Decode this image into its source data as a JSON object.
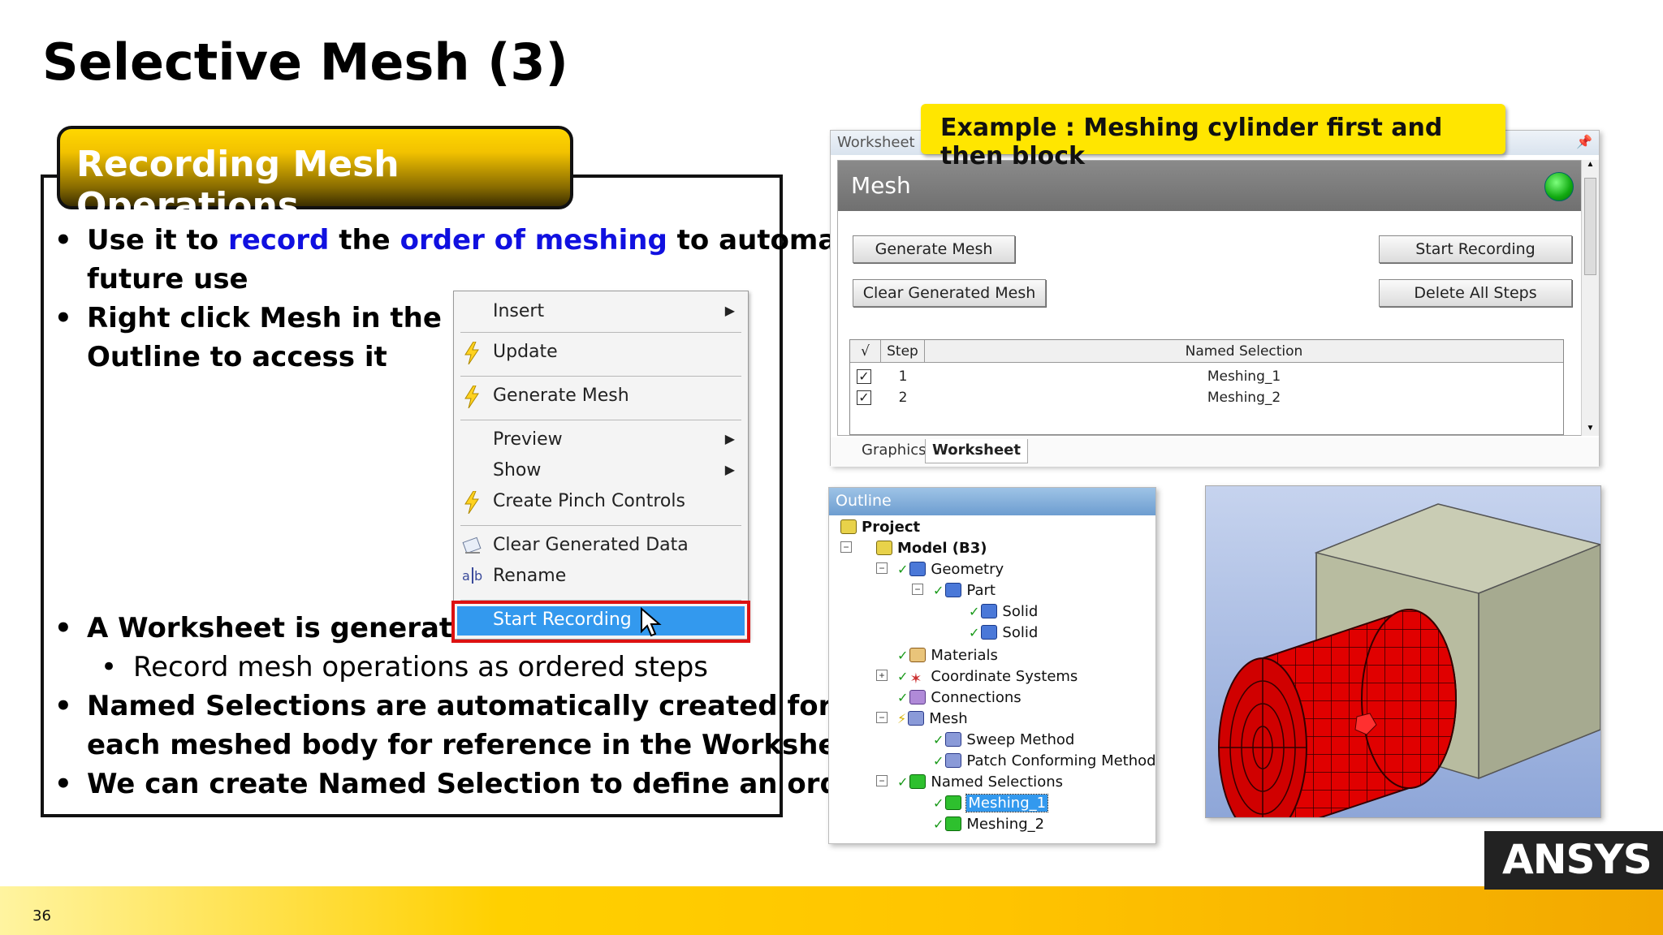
{
  "slide": {
    "title": "Selective Mesh (3)",
    "page_number": "36"
  },
  "section": {
    "title": "Recording Mesh Operations"
  },
  "bullets": {
    "b1_part1": "Use it to ",
    "b1_hl1": "record",
    "b1_part2": " the ",
    "b1_hl2": "order of meshing",
    "b1_part3": " to automate",
    "b1_line2": "future use",
    "b2_line1": "Right click Mesh in the",
    "b2_line2": "Outline to access it",
    "b3": "A Worksheet is generated",
    "b3_sub": "Record mesh operations as ordered steps",
    "b4_line1": "Named Selections are automatically created for",
    "b4_line2": "each meshed body for reference in the Worksheet",
    "b5": "We can create Named Selection to define an order"
  },
  "context_menu": {
    "items": [
      {
        "label": "Insert",
        "has_submenu": true
      },
      {
        "label": "Update",
        "icon": "lightning-icon"
      },
      {
        "label": "Generate Mesh",
        "icon": "lightning-icon"
      },
      {
        "label": "Preview",
        "has_submenu": true
      },
      {
        "label": "Show",
        "has_submenu": true
      },
      {
        "label": "Create Pinch Controls",
        "icon": "lightning-icon"
      },
      {
        "label": "Clear Generated Data",
        "icon": "eraser-icon"
      },
      {
        "label": "Rename",
        "icon": "rename-icon"
      },
      {
        "label": "Start Recording",
        "active": true
      }
    ]
  },
  "example_banner": "Example : Meshing cylinder first and then block",
  "worksheet": {
    "window_title": "Worksheet",
    "panel_title": "Mesh",
    "status_color": "#11aa11",
    "buttons": {
      "generate_mesh": "Generate Mesh",
      "clear_generated_mesh": "Clear Generated Mesh",
      "start_recording": "Start Recording",
      "delete_all_steps": "Delete All Steps"
    },
    "table": {
      "headers": {
        "check": "√",
        "step": "Step",
        "named_selection": "Named Selection"
      },
      "rows": [
        {
          "checked": true,
          "step": "1",
          "named_selection": "Meshing_1"
        },
        {
          "checked": true,
          "step": "2",
          "named_selection": "Meshing_2"
        }
      ]
    },
    "tabs": {
      "graphics": "Graphics",
      "worksheet": "Worksheet"
    }
  },
  "outline": {
    "title": "Outline",
    "nodes": {
      "project": "Project",
      "model": "Model (B3)",
      "geometry": "Geometry",
      "part": "Part",
      "solid1": "Solid",
      "solid2": "Solid",
      "materials": "Materials",
      "coordinate_systems": "Coordinate Systems",
      "connections": "Connections",
      "mesh": "Mesh",
      "sweep_method": "Sweep Method",
      "patch_conforming": "Patch Conforming Method",
      "named_selections": "Named Selections",
      "meshing1": "Meshing_1",
      "meshing2": "Meshing_2"
    }
  },
  "logo": {
    "text": "ANSYS"
  },
  "colors": {
    "highlight_blue": "#1010e0",
    "accent_yellow": "#ffd700",
    "record_outline": "#dd1111",
    "menu_selected": "#3399ee"
  }
}
